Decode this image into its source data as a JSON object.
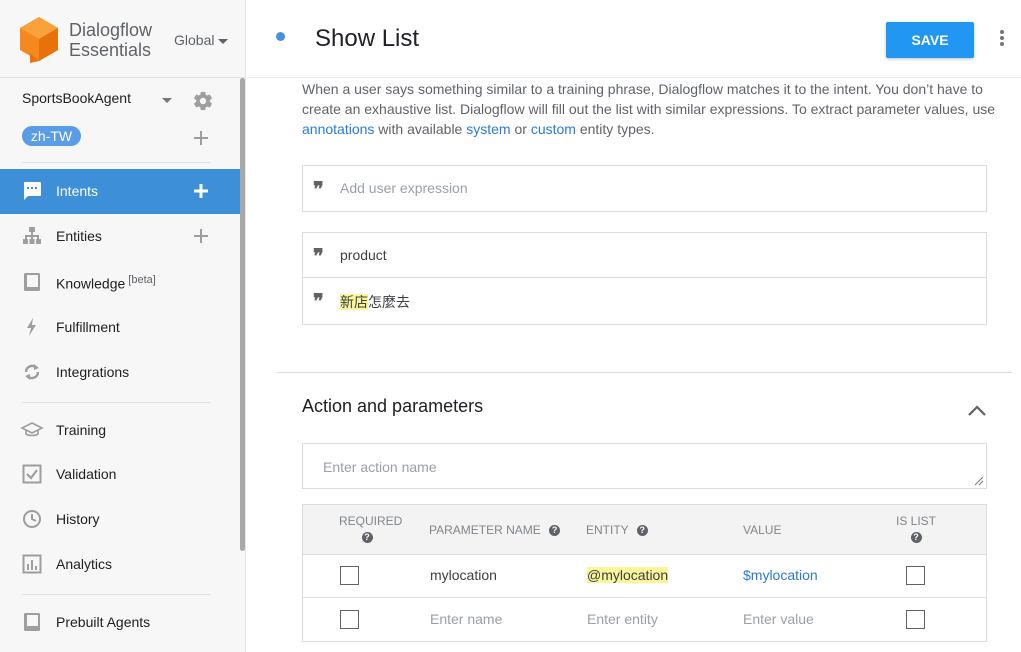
{
  "brand": {
    "name_line1": "Dialogflow",
    "name_line2": "Essentials",
    "region": "Global"
  },
  "agent": {
    "name": "SportsBookAgent",
    "language": "zh-TW"
  },
  "nav": {
    "intents": "Intents",
    "entities": "Entities",
    "knowledge": "Knowledge",
    "knowledge_tag": "[beta]",
    "fulfillment": "Fulfillment",
    "integrations": "Integrations",
    "training": "Training",
    "validation": "Validation",
    "history": "History",
    "analytics": "Analytics",
    "prebuilt": "Prebuilt Agents"
  },
  "header": {
    "title": "Show List",
    "save_label": "SAVE"
  },
  "training": {
    "help_part1": "When a user says something similar to a training phrase, Dialogflow matches it to the intent. You don’t have to create an exhaustive list. Dialogflow will fill out the list with similar expressions. To extract parameter values, use",
    "help_link_annotations": "annotations",
    "help_part2": "with available",
    "help_link_system": "system",
    "help_part3": "or",
    "help_link_custom": "custom",
    "help_part4": "entity types.",
    "add_placeholder": "Add user expression",
    "phrases": [
      {
        "text": "product"
      },
      {
        "highlight": "新店",
        "rest": "怎麼去"
      }
    ]
  },
  "actions": {
    "title": "Action and parameters",
    "action_placeholder": "Enter action name",
    "columns": {
      "required": "REQUIRED",
      "name": "PARAMETER NAME",
      "entity": "ENTITY",
      "value": "VALUE",
      "is_list": "IS LIST"
    },
    "rows": [
      {
        "name": "mylocation",
        "entity": "@mylocation",
        "value": "$mylocation"
      }
    ],
    "new_row": {
      "name_placeholder": "Enter name",
      "entity_placeholder": "Enter entity",
      "value_placeholder": "Enter value"
    }
  },
  "colors": {
    "accent": "#3d8fd8",
    "save": "#2196f3",
    "link": "#2a7ad3",
    "highlight": "#fbf59a"
  }
}
